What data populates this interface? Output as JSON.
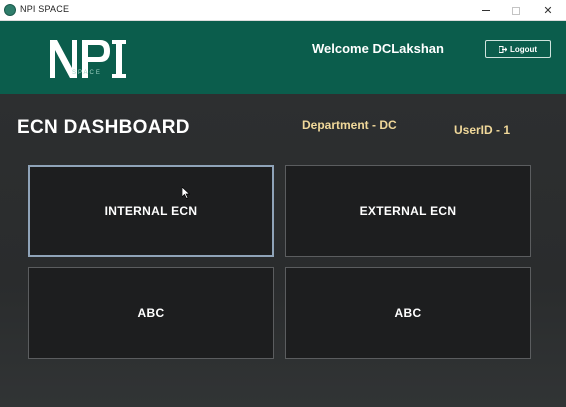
{
  "window": {
    "title": "NPI SPACE",
    "controls": {
      "minimize": "minimize",
      "maximize": "maximize",
      "close": "✕"
    }
  },
  "header": {
    "logo_text": "NPI",
    "logo_subtext": "SPACE",
    "welcome": "Welcome DCLakshan",
    "logout_label": "Logout",
    "background_color": "#0b5d4c"
  },
  "dashboard": {
    "title": "ECN DASHBOARD",
    "department": "Department - DC",
    "user_id": "UserID - 1",
    "tiles": [
      {
        "label": "INTERNAL ECN"
      },
      {
        "label": "EXTERNAL ECN"
      },
      {
        "label": "ABC"
      },
      {
        "label": "ABC"
      }
    ]
  },
  "icons": {
    "app": "app-logo-icon",
    "logout": "logout-icon"
  },
  "colors": {
    "accent_gold": "#f0d89a",
    "tile_background": "#1d1e1f",
    "page_background": "#2b2d2e"
  }
}
